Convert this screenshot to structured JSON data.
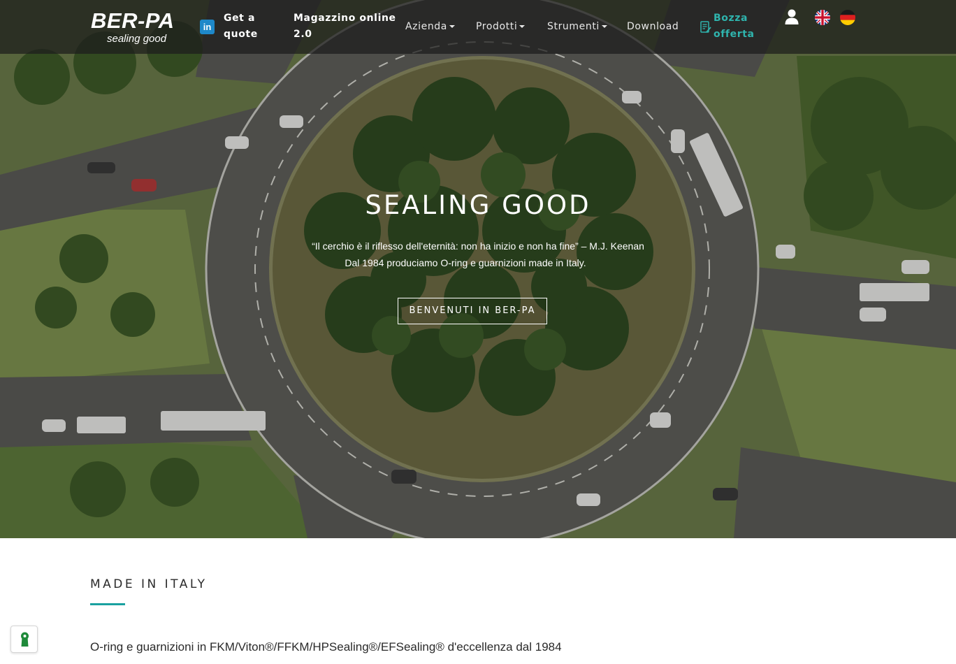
{
  "brand": {
    "name": "BER-PA",
    "tagline": "sealing good"
  },
  "nav": {
    "linkedin_label": "in",
    "quote_line1": "Get a",
    "quote_line2": "quote",
    "shop_line1": "Magazzino online",
    "shop_line2": "2.0",
    "items": [
      {
        "label": "Azienda",
        "dropdown": true
      },
      {
        "label": "Prodotti",
        "dropdown": true
      },
      {
        "label": "Strumenti",
        "dropdown": true
      },
      {
        "label": "Download",
        "dropdown": false
      }
    ],
    "bozza_line1": "Bozza",
    "bozza_line2": "offerta",
    "languages": [
      "en",
      "de"
    ]
  },
  "hero": {
    "title": "SEALING GOOD",
    "quote": "“Il cerchio è il riflesso dell'eternità: non ha inizio e non ha fine” – M.J. Keenan",
    "subtitle": "Dal 1984 produciamo O-ring e guarnizioni made in Italy.",
    "button": "BENVENUTI IN BER-PA"
  },
  "section": {
    "title": "MADE IN ITALY",
    "text": "O-ring e guarnizioni in FKM/Viton®/FFKM/HPSealing®/EFSealing® d'eccellenza dal 1984"
  },
  "colors": {
    "accent": "#1aa1a0",
    "bozza": "#2fb4ad",
    "linkedin": "#1e88c9"
  }
}
